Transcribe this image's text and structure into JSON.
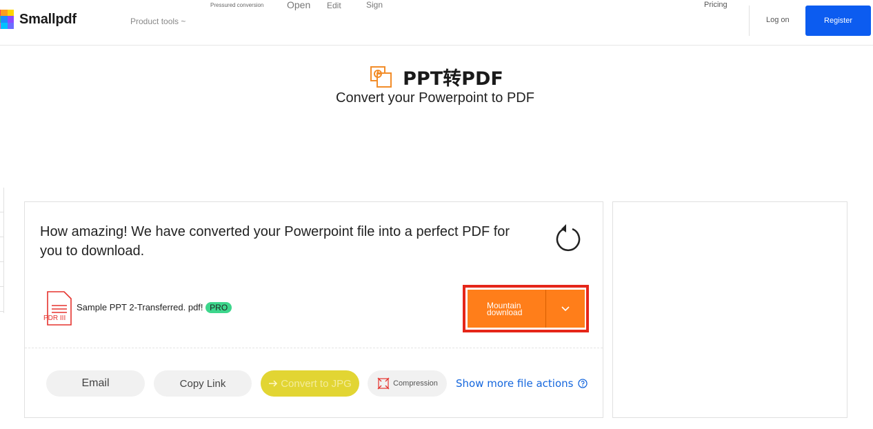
{
  "header": {
    "logo_text": "Smallpdf",
    "logo_colors": [
      "#ff3d5a",
      "#ff9e1b",
      "#ffd500",
      "#37c871",
      "#1f8bff",
      "#8d4bff",
      "#ff4fa3",
      "#00c2ff",
      "#6b6bff"
    ],
    "product_tools": "Product tools ~",
    "nav": {
      "pressured": "Pressured conversion",
      "open": "Open",
      "edit": "Edit",
      "sign": "Sign",
      "pricing": "Pricing"
    },
    "login": "Log on",
    "register": "Register",
    "register_color": "#0c5cf0"
  },
  "page": {
    "title": "PPT转PDF",
    "subtitle": "Convert your Powerpoint to PDF",
    "title_icon": "ppt-icon",
    "accent_color": "#f28c28"
  },
  "result": {
    "message": "How amazing! We have converted your Powerpoint file into a perfect PDF for you to download.",
    "file_icon_label": "PDR III",
    "file_name": "Sample PPT 2-Transferred. pdf!",
    "pro_badge": "PRO",
    "download_label": "Mountain download",
    "download_color": "#ff7e1a",
    "actions": {
      "email": "Email",
      "copy_link": "Copy Link",
      "convert_jpg": "Convert to JPG",
      "compression": "Compression"
    },
    "show_more": "Show more file actions"
  }
}
